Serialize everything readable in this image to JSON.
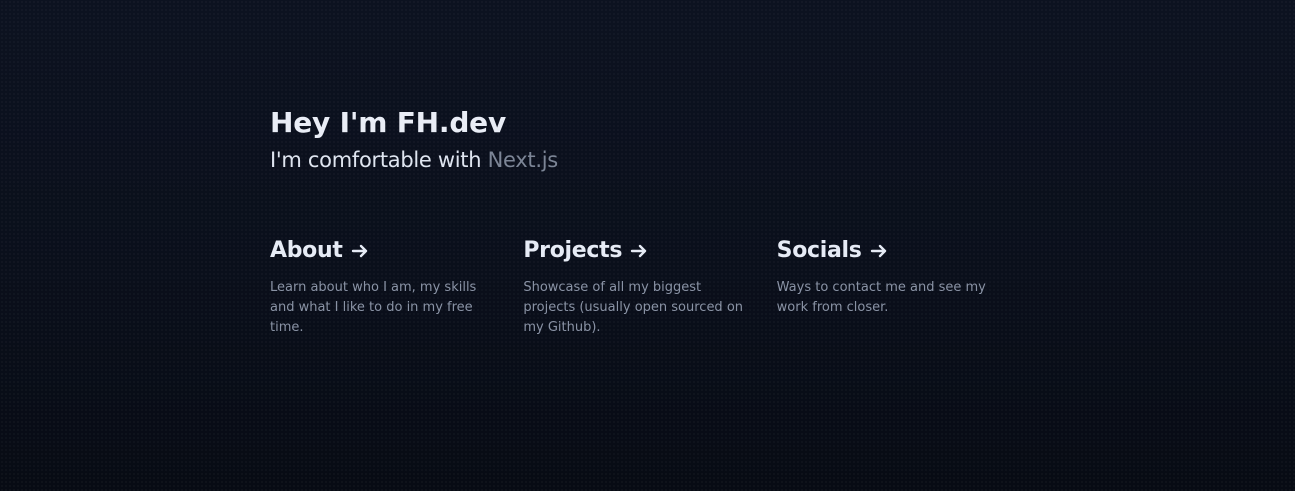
{
  "hero": {
    "title": "Hey I'm FH.dev",
    "tagline_prefix": "I'm comfortable with",
    "tagline_tech": "Next.js"
  },
  "cards": [
    {
      "title": "About",
      "icon": "arrow-right-icon",
      "description": "Learn about who I am, my skills and what I like to do in my free time."
    },
    {
      "title": "Projects",
      "icon": "arrow-right-icon",
      "description": "Showcase of all my biggest projects (usually open sourced on my Github)."
    },
    {
      "title": "Socials",
      "icon": "arrow-right-icon",
      "description": "Ways to contact me and see my work from closer."
    }
  ],
  "colors": {
    "background": "#0b101c",
    "heading": "#e9edf6",
    "muted": "#8a93a5",
    "tech_accent": "#7c8596"
  }
}
